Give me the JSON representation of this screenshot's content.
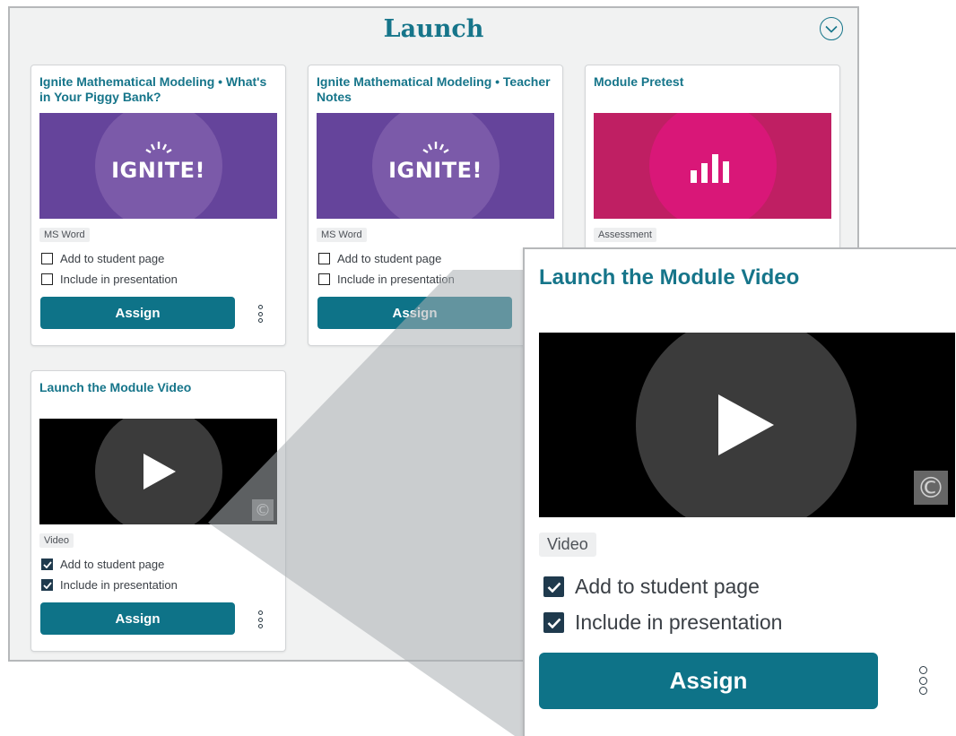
{
  "panel": {
    "title": "Launch"
  },
  "cards": [
    {
      "title": "Ignite Mathematical Modeling • What's in Your Piggy Bank?",
      "thumbnail": "ignite-logo",
      "logo_text": "IGNITE!",
      "tag": "MS Word",
      "add_to_student_page": {
        "label": "Add to student page",
        "checked": false
      },
      "include_in_presentation": {
        "label": "Include in presentation",
        "checked": false
      },
      "assign_label": "Assign"
    },
    {
      "title": "Ignite Mathematical Modeling • Teacher Notes",
      "thumbnail": "ignite-logo",
      "logo_text": "IGNITE!",
      "tag": "MS Word",
      "add_to_student_page": {
        "label": "Add to student page",
        "checked": false
      },
      "include_in_presentation": {
        "label": "Include in presentation",
        "checked": false
      },
      "assign_label": "Assign"
    },
    {
      "title": "Module Pretest",
      "thumbnail": "bar-chart-icon",
      "tag": "Assessment"
    },
    {
      "title": "Launch the Module Video",
      "thumbnail": "play-icon",
      "tag": "Video",
      "add_to_student_page": {
        "label": "Add to student page",
        "checked": true
      },
      "include_in_presentation": {
        "label": "Include in presentation",
        "checked": true
      },
      "assign_label": "Assign"
    }
  ],
  "zoom": {
    "title": "Launch the Module Video",
    "tag": "Video",
    "add_to_student_page": {
      "label": "Add to student page",
      "checked": true
    },
    "include_in_presentation": {
      "label": "Include in presentation",
      "checked": true
    },
    "assign_label": "Assign"
  },
  "colors": {
    "accent": "#16758a",
    "button": "#0e7388",
    "ignite_purple": "#65449b",
    "assessment_pink": "#d91778"
  },
  "icons": [
    "chevron-down-icon",
    "more-options-icon",
    "play-icon",
    "bar-chart-icon",
    "copyright-icon",
    "checkbox-icon"
  ]
}
